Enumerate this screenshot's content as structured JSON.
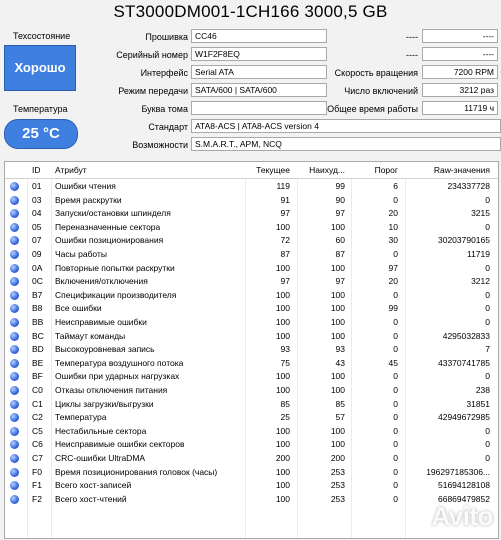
{
  "title": "ST3000DM001-1CH166 3000,5 GB",
  "left": {
    "health_label": "Техсостояние",
    "health_value": "Хорошо",
    "temp_label": "Температура",
    "temp_value": "25 °C"
  },
  "info": {
    "firmware_label": "Прошивка",
    "firmware": "CC46",
    "serial_label": "Серийный номер",
    "serial": "W1F2F8EQ",
    "interface_label": "Интерфейс",
    "interface": "Serial ATA",
    "transfer_label": "Режим передачи",
    "transfer": "SATA/600 | SATA/600",
    "letter_label": "Буква тома",
    "letter": "",
    "standard_label": "Стандарт",
    "standard": "ATA8-ACS | ATA8-ACS version 4",
    "features_label": "Возможности",
    "features": "S.M.A.R.T., APM, NCQ",
    "dash1": "----",
    "dash1_val": "----",
    "dash2": "----",
    "dash2_val": "----",
    "rpm_label": "Скорость вращения",
    "rpm": "7200 RPM",
    "power_count_label": "Число включений",
    "power_count": "3212 раз",
    "power_hours_label": "Общее время работы",
    "power_hours": "11719 ч"
  },
  "table": {
    "headers": {
      "id": "ID",
      "attr": "Атрибут",
      "current": "Текущее",
      "worst": "Наихуд...",
      "threshold": "Порог",
      "raw": "Raw-значения"
    },
    "rows": [
      {
        "id": "01",
        "attr": "Ошибки чтения",
        "cur": "119",
        "worst": "99",
        "thr": "6",
        "raw": "234337728"
      },
      {
        "id": "03",
        "attr": "Время раскрутки",
        "cur": "91",
        "worst": "90",
        "thr": "0",
        "raw": "0"
      },
      {
        "id": "04",
        "attr": "Запуски/остановки шпинделя",
        "cur": "97",
        "worst": "97",
        "thr": "20",
        "raw": "3215"
      },
      {
        "id": "05",
        "attr": "Переназначенные сектора",
        "cur": "100",
        "worst": "100",
        "thr": "10",
        "raw": "0"
      },
      {
        "id": "07",
        "attr": "Ошибки позиционирования",
        "cur": "72",
        "worst": "60",
        "thr": "30",
        "raw": "30203790165"
      },
      {
        "id": "09",
        "attr": "Часы работы",
        "cur": "87",
        "worst": "87",
        "thr": "0",
        "raw": "11719"
      },
      {
        "id": "0A",
        "attr": "Повторные попытки раскрутки",
        "cur": "100",
        "worst": "100",
        "thr": "97",
        "raw": "0"
      },
      {
        "id": "0C",
        "attr": "Включения/отключения",
        "cur": "97",
        "worst": "97",
        "thr": "20",
        "raw": "3212"
      },
      {
        "id": "B7",
        "attr": "Спецификации производителя",
        "cur": "100",
        "worst": "100",
        "thr": "0",
        "raw": "0"
      },
      {
        "id": "B8",
        "attr": "Все ошибки",
        "cur": "100",
        "worst": "100",
        "thr": "99",
        "raw": "0"
      },
      {
        "id": "BB",
        "attr": "Неисправимые ошибки",
        "cur": "100",
        "worst": "100",
        "thr": "0",
        "raw": "0"
      },
      {
        "id": "BC",
        "attr": "Таймаут команды",
        "cur": "100",
        "worst": "100",
        "thr": "0",
        "raw": "4295032833"
      },
      {
        "id": "BD",
        "attr": "Высокоуровневая запись",
        "cur": "93",
        "worst": "93",
        "thr": "0",
        "raw": "7"
      },
      {
        "id": "BE",
        "attr": "Температура воздушного потока",
        "cur": "75",
        "worst": "43",
        "thr": "45",
        "raw": "43370741785"
      },
      {
        "id": "BF",
        "attr": "Ошибки при ударных нагрузках",
        "cur": "100",
        "worst": "100",
        "thr": "0",
        "raw": "0"
      },
      {
        "id": "C0",
        "attr": "Отказы отключения питания",
        "cur": "100",
        "worst": "100",
        "thr": "0",
        "raw": "238"
      },
      {
        "id": "C1",
        "attr": "Циклы загрузки/выгрузки",
        "cur": "85",
        "worst": "85",
        "thr": "0",
        "raw": "31851"
      },
      {
        "id": "C2",
        "attr": "Температура",
        "cur": "25",
        "worst": "57",
        "thr": "0",
        "raw": "42949672985"
      },
      {
        "id": "C5",
        "attr": "Нестабильные сектора",
        "cur": "100",
        "worst": "100",
        "thr": "0",
        "raw": "0"
      },
      {
        "id": "C6",
        "attr": "Неисправимые ошибки секторов",
        "cur": "100",
        "worst": "100",
        "thr": "0",
        "raw": "0"
      },
      {
        "id": "C7",
        "attr": "CRC-ошибки UltraDMA",
        "cur": "200",
        "worst": "200",
        "thr": "0",
        "raw": "0"
      },
      {
        "id": "F0",
        "attr": "Время позиционирования головок (часы)",
        "cur": "100",
        "worst": "253",
        "thr": "0",
        "raw": "196297185306..."
      },
      {
        "id": "F1",
        "attr": "Всего хост-записей",
        "cur": "100",
        "worst": "253",
        "thr": "0",
        "raw": "51694128108"
      },
      {
        "id": "F2",
        "attr": "Всего хост-чтений",
        "cur": "100",
        "worst": "253",
        "thr": "0",
        "raw": "66869479852"
      }
    ]
  },
  "watermark": "Avito",
  "colors": {
    "accent": "#3f7fe0",
    "status_dot": "#3d6fe0"
  }
}
